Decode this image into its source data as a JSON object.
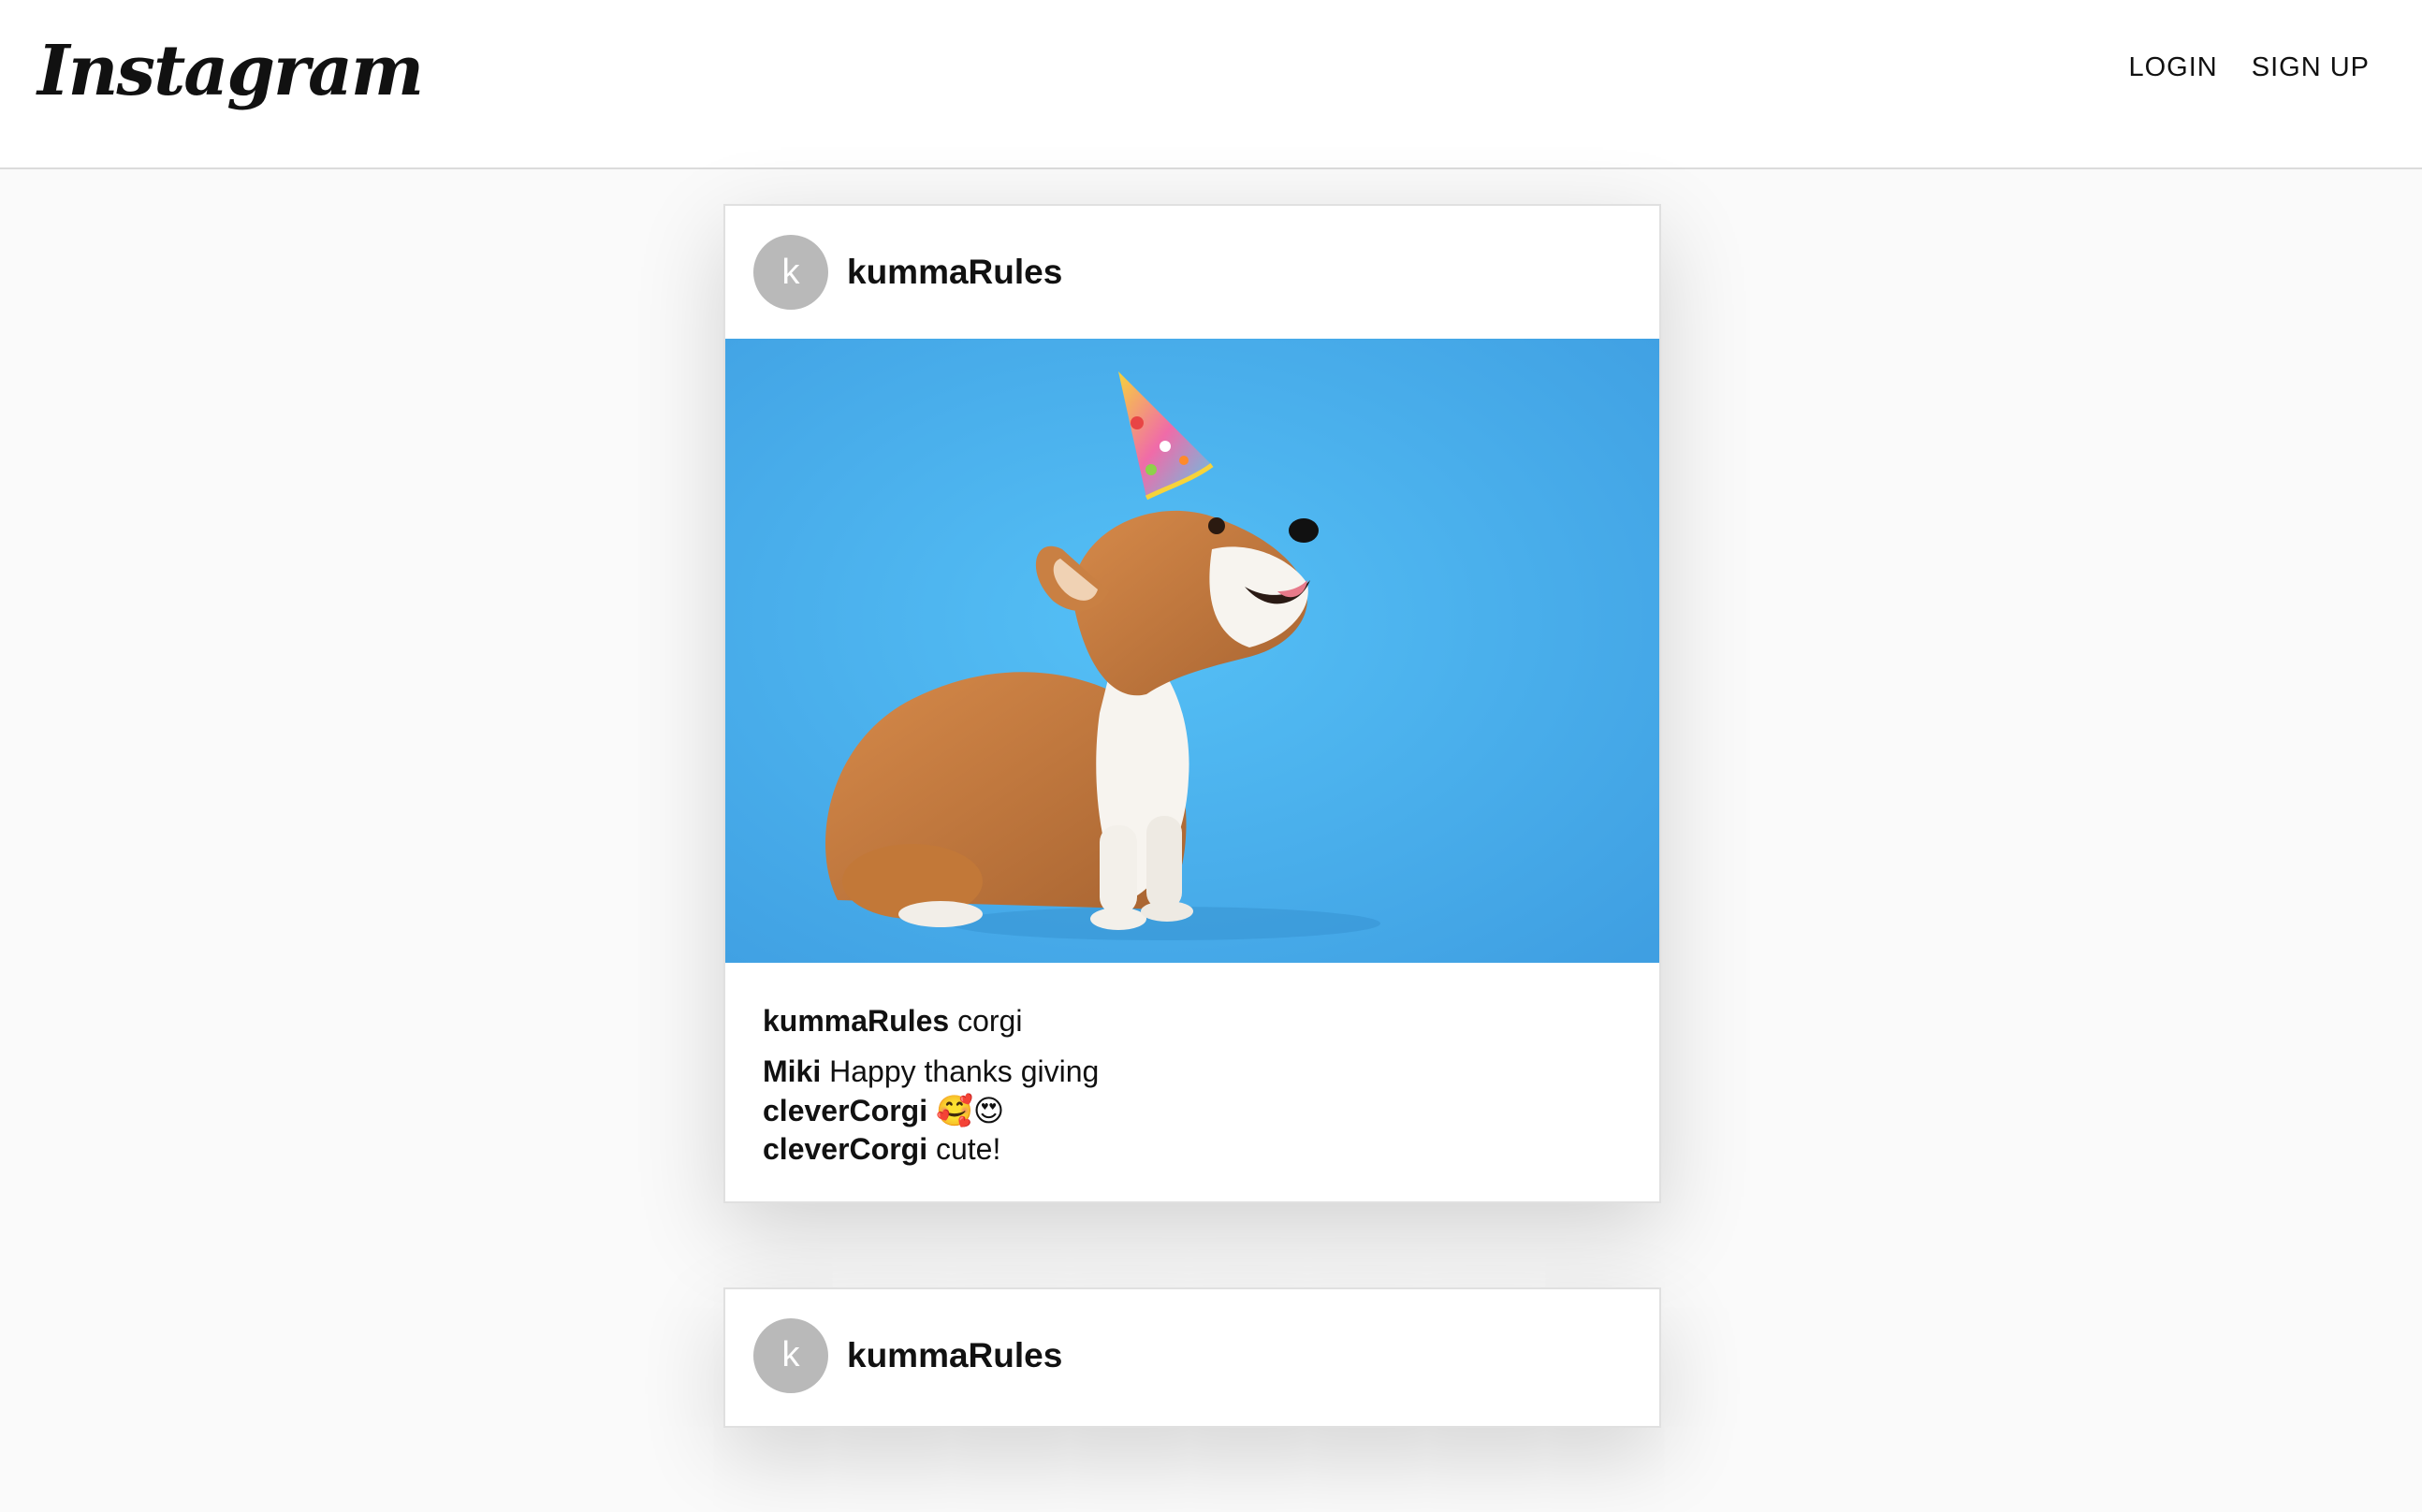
{
  "header": {
    "logo_text": "Instagram",
    "nav": {
      "login_label": "LOGIN",
      "signup_label": "SIGN UP"
    }
  },
  "posts": [
    {
      "avatar_letter": "k",
      "username": "kummaRules",
      "image": "corgi-party-hat-photo",
      "caption_user": "kummaRules",
      "caption_text": "corgi",
      "comments": [
        {
          "user": "Miki",
          "text": "Happy thanks giving"
        },
        {
          "user": "cleverCorgi",
          "text": "🥰😍"
        },
        {
          "user": "cleverCorgi",
          "text": "cute!"
        }
      ]
    },
    {
      "avatar_letter": "k",
      "username": "kummaRules"
    }
  ],
  "colors": {
    "background": "#fafafa",
    "card": "#ffffff",
    "avatar": "#b9b9b9",
    "photo_background": "#4fb6f0"
  }
}
